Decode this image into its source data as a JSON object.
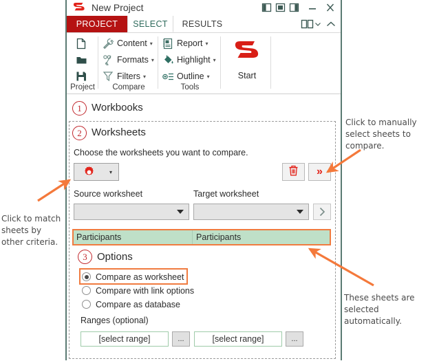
{
  "window": {
    "title": "New Project",
    "logo_icon": "synkronizer-logo-icon",
    "controls": {
      "layout_1_icon": "layout-left-pane-icon",
      "layout_2_icon": "layout-center-pane-icon",
      "layout_3_icon": "layout-right-pane-icon",
      "minimize_icon": "minimize-icon",
      "close_icon": "close-icon"
    }
  },
  "tabs": [
    {
      "label": "PROJECT",
      "active": false
    },
    {
      "label": "SELECT",
      "active": true
    },
    {
      "label": "RESULTS",
      "active": false
    }
  ],
  "ribbon_right": {
    "display_options_icon": "ribbon-display-options-icon",
    "collapse_icon": "chevron-up-icon"
  },
  "ribbon": {
    "groups": [
      {
        "label": "Project",
        "items": [
          {
            "label": "",
            "icon": "new-file-icon"
          },
          {
            "label": "",
            "icon": "open-folder-icon"
          },
          {
            "label": "",
            "icon": "save-disk-icon"
          }
        ]
      },
      {
        "label": "Compare",
        "items": [
          {
            "label": "Content",
            "icon": "wrench-icon",
            "caret": "▾"
          },
          {
            "label": "Formats",
            "icon": "percent-brush-icon",
            "caret": "▾"
          },
          {
            "label": "Filters",
            "icon": "funnel-icon",
            "caret": "▾"
          }
        ]
      },
      {
        "label": "Tools",
        "items": [
          {
            "label": "Report",
            "icon": "report-book-icon",
            "caret": "▾"
          },
          {
            "label": "Highlight",
            "icon": "paint-bucket-icon",
            "caret": "▾"
          },
          {
            "label": "Outline",
            "icon": "outline-list-icon",
            "caret": "▾"
          }
        ]
      }
    ],
    "start": {
      "label": "Start",
      "icon": "synkronizer-start-icon"
    }
  },
  "steps": {
    "step1": {
      "number": "1",
      "title": "Workbooks"
    },
    "step2": {
      "number": "2",
      "title": "Worksheets",
      "description": "Choose the worksheets you want to compare.",
      "match_button_icon": "gear-icon",
      "match_button_caret": "▾",
      "delete_button_icon": "trash-icon",
      "manual_select_button_icon": "double-chevron-right-icon",
      "manual_select_button_label": "»",
      "source_label": "Source worksheet",
      "target_label": "Target worksheet",
      "source_value": "",
      "target_value": "",
      "add_pair_icon": "chevron-right-icon",
      "add_pair_label": "›",
      "sheet_pairs": [
        {
          "source": "Participants",
          "target": "Participants"
        }
      ]
    },
    "step3": {
      "number": "3",
      "title": "Options",
      "radios": [
        {
          "label": "Compare as worksheet",
          "checked": true
        },
        {
          "label": "Compare with link options",
          "checked": false
        },
        {
          "label": "Compare as database",
          "checked": false
        }
      ],
      "ranges_label": "Ranges (optional)",
      "range_source_value": "[select range]",
      "range_target_value": "[select range]",
      "range_browse_label": "..."
    }
  },
  "annotations": {
    "manual_select": "Click to manually select sheets to compare.",
    "match_criteria": "Click to match sheets by other criteria.",
    "auto_selected": "These sheets are selected automatically."
  },
  "colors": {
    "accent_red": "#b51212",
    "logo_red": "#e2231a",
    "tab_select_text": "#2f6b5c",
    "sheet_row_green": "#bfe0c8",
    "highlight_orange": "#f07b3f",
    "window_border": "#5a7a72",
    "step_circle_red": "#c1272d"
  }
}
